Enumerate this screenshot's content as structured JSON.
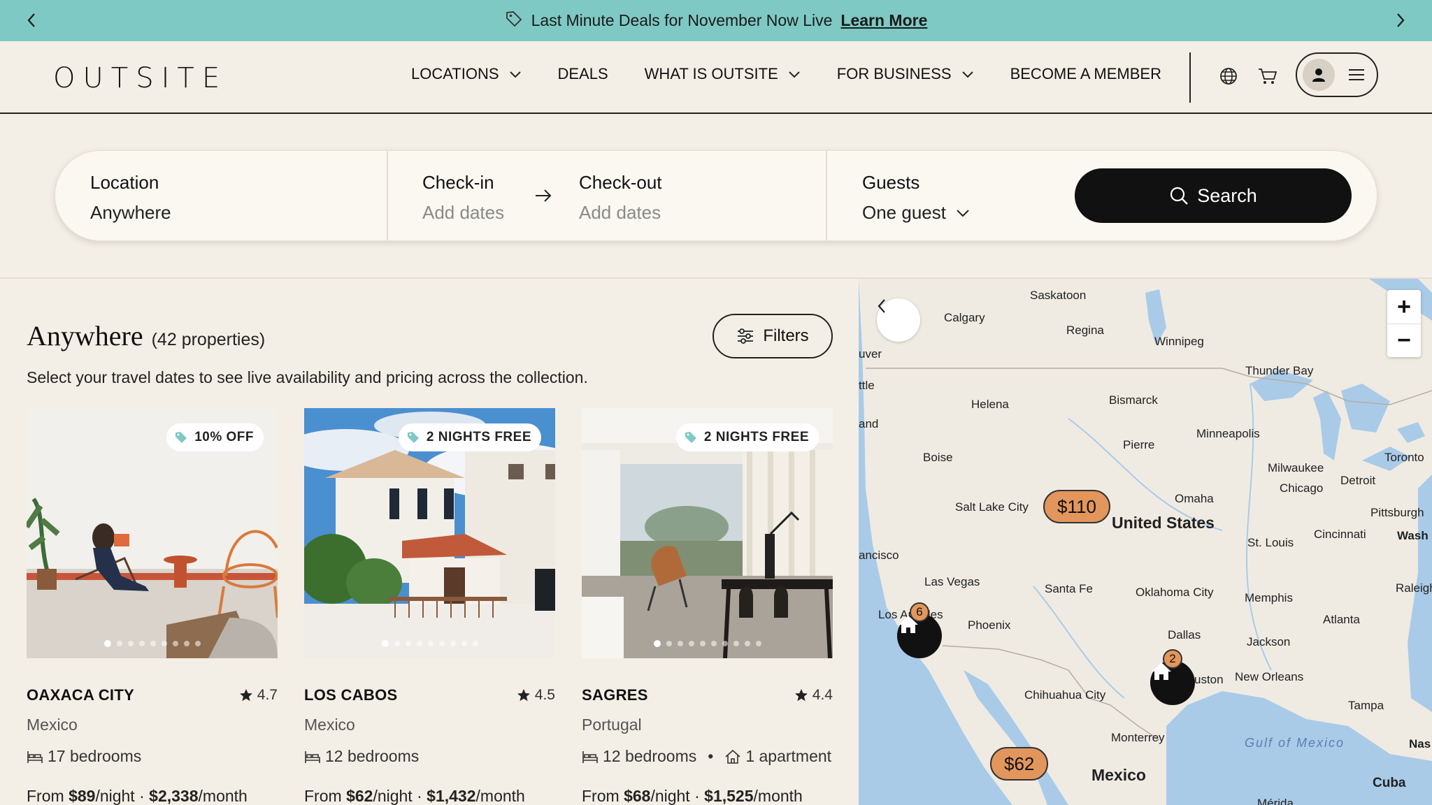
{
  "promo": {
    "text": "Last Minute Deals for November Now Live",
    "link": "Learn More",
    "bg_color": "#7ec9c4"
  },
  "header": {
    "logo": "OUTSITE",
    "nav": [
      {
        "label": "LOCATIONS",
        "has_dropdown": true
      },
      {
        "label": "DEALS",
        "has_dropdown": false
      },
      {
        "label": "WHAT IS OUTSITE",
        "has_dropdown": true
      },
      {
        "label": "FOR BUSINESS",
        "has_dropdown": true
      },
      {
        "label": "BECOME A MEMBER",
        "has_dropdown": false
      }
    ],
    "icons": [
      "globe-icon",
      "cart-icon",
      "user-icon",
      "menu-icon"
    ]
  },
  "search": {
    "location_label": "Location",
    "location_value": "Anywhere",
    "checkin_label": "Check-in",
    "checkin_value": "Add dates",
    "checkout_label": "Check-out",
    "checkout_value": "Add dates",
    "guests_label": "Guests",
    "guests_value": "One guest",
    "button_label": "Search"
  },
  "listing": {
    "title": "Anywhere",
    "count": "(42 properties)",
    "filters_label": "Filters",
    "subtitle": "Select your travel dates to see live availability and pricing across the collection."
  },
  "cards": [
    {
      "badge": "10% OFF",
      "city": "OAXACA CITY",
      "rating": "4.7",
      "country": "Mexico",
      "beds": "17 bedrooms",
      "apartments": "",
      "price_from_label": "From",
      "night_price": "$89",
      "night_unit": "/night",
      "month_price": "$2,338",
      "month_unit": "/month"
    },
    {
      "badge": "2 NIGHTS FREE",
      "city": "LOS CABOS",
      "rating": "4.5",
      "country": "Mexico",
      "beds": "12 bedrooms",
      "apartments": "",
      "price_from_label": "From",
      "night_price": "$62",
      "night_unit": "/night",
      "month_price": "$1,432",
      "month_unit": "/month"
    },
    {
      "badge": "2 NIGHTS FREE",
      "city": "SAGRES",
      "rating": "4.4",
      "country": "Portugal",
      "beds": "12 bedrooms",
      "apartments": "1 apartment",
      "price_from_label": "From",
      "night_price": "$68",
      "night_unit": "/night",
      "month_price": "$1,525",
      "month_unit": "/month"
    }
  ],
  "map": {
    "pins": [
      {
        "label": "$110"
      },
      {
        "label": "$62"
      }
    ],
    "clusters": [
      {
        "count": "6"
      },
      {
        "count": "2"
      }
    ],
    "labels": {
      "saskatoon": "Saskatoon",
      "calgary": "Calgary",
      "regina": "Regina",
      "winnipeg": "Winnipeg",
      "thunder_bay": "Thunder Bay",
      "uver": "uver",
      "ttle": "ttle",
      "helena": "Helena",
      "bismarck": "Bismarck",
      "and": "and",
      "pierre": "Pierre",
      "minneapolis": "Minneapolis",
      "boise": "Boise",
      "milwaukee": "Milwaukee",
      "toronto": "Toronto",
      "detroit": "Detroit",
      "chicago": "Chicago",
      "salt_lake": "Salt Lake City",
      "omaha": "Omaha",
      "pittsburgh": "Pittsburgh",
      "united_states": "United States",
      "st_louis": "St. Louis",
      "cincinnati": "Cincinnati",
      "wash": "Wash",
      "ancisco": "ancisco",
      "las_vegas": "Las Vegas",
      "santa_fe": "Santa Fe",
      "oklahoma_city": "Oklahoma City",
      "memphis": "Memphis",
      "raleigh": "Raleigh",
      "los_angeles": "Los Angeles",
      "phoenix": "Phoenix",
      "atlanta": "Atlanta",
      "dallas": "Dallas",
      "jackson": "Jackson",
      "houston": "uston",
      "new_orleans": "New Orleans",
      "chihuahua": "Chihuahua City",
      "tampa": "Tampa",
      "monterrey": "Monterrey",
      "gulf": "Gulf of Mexico",
      "nas": "Nas",
      "mexico": "Mexico",
      "cuba": "Cuba",
      "merida": "Mérida"
    }
  }
}
